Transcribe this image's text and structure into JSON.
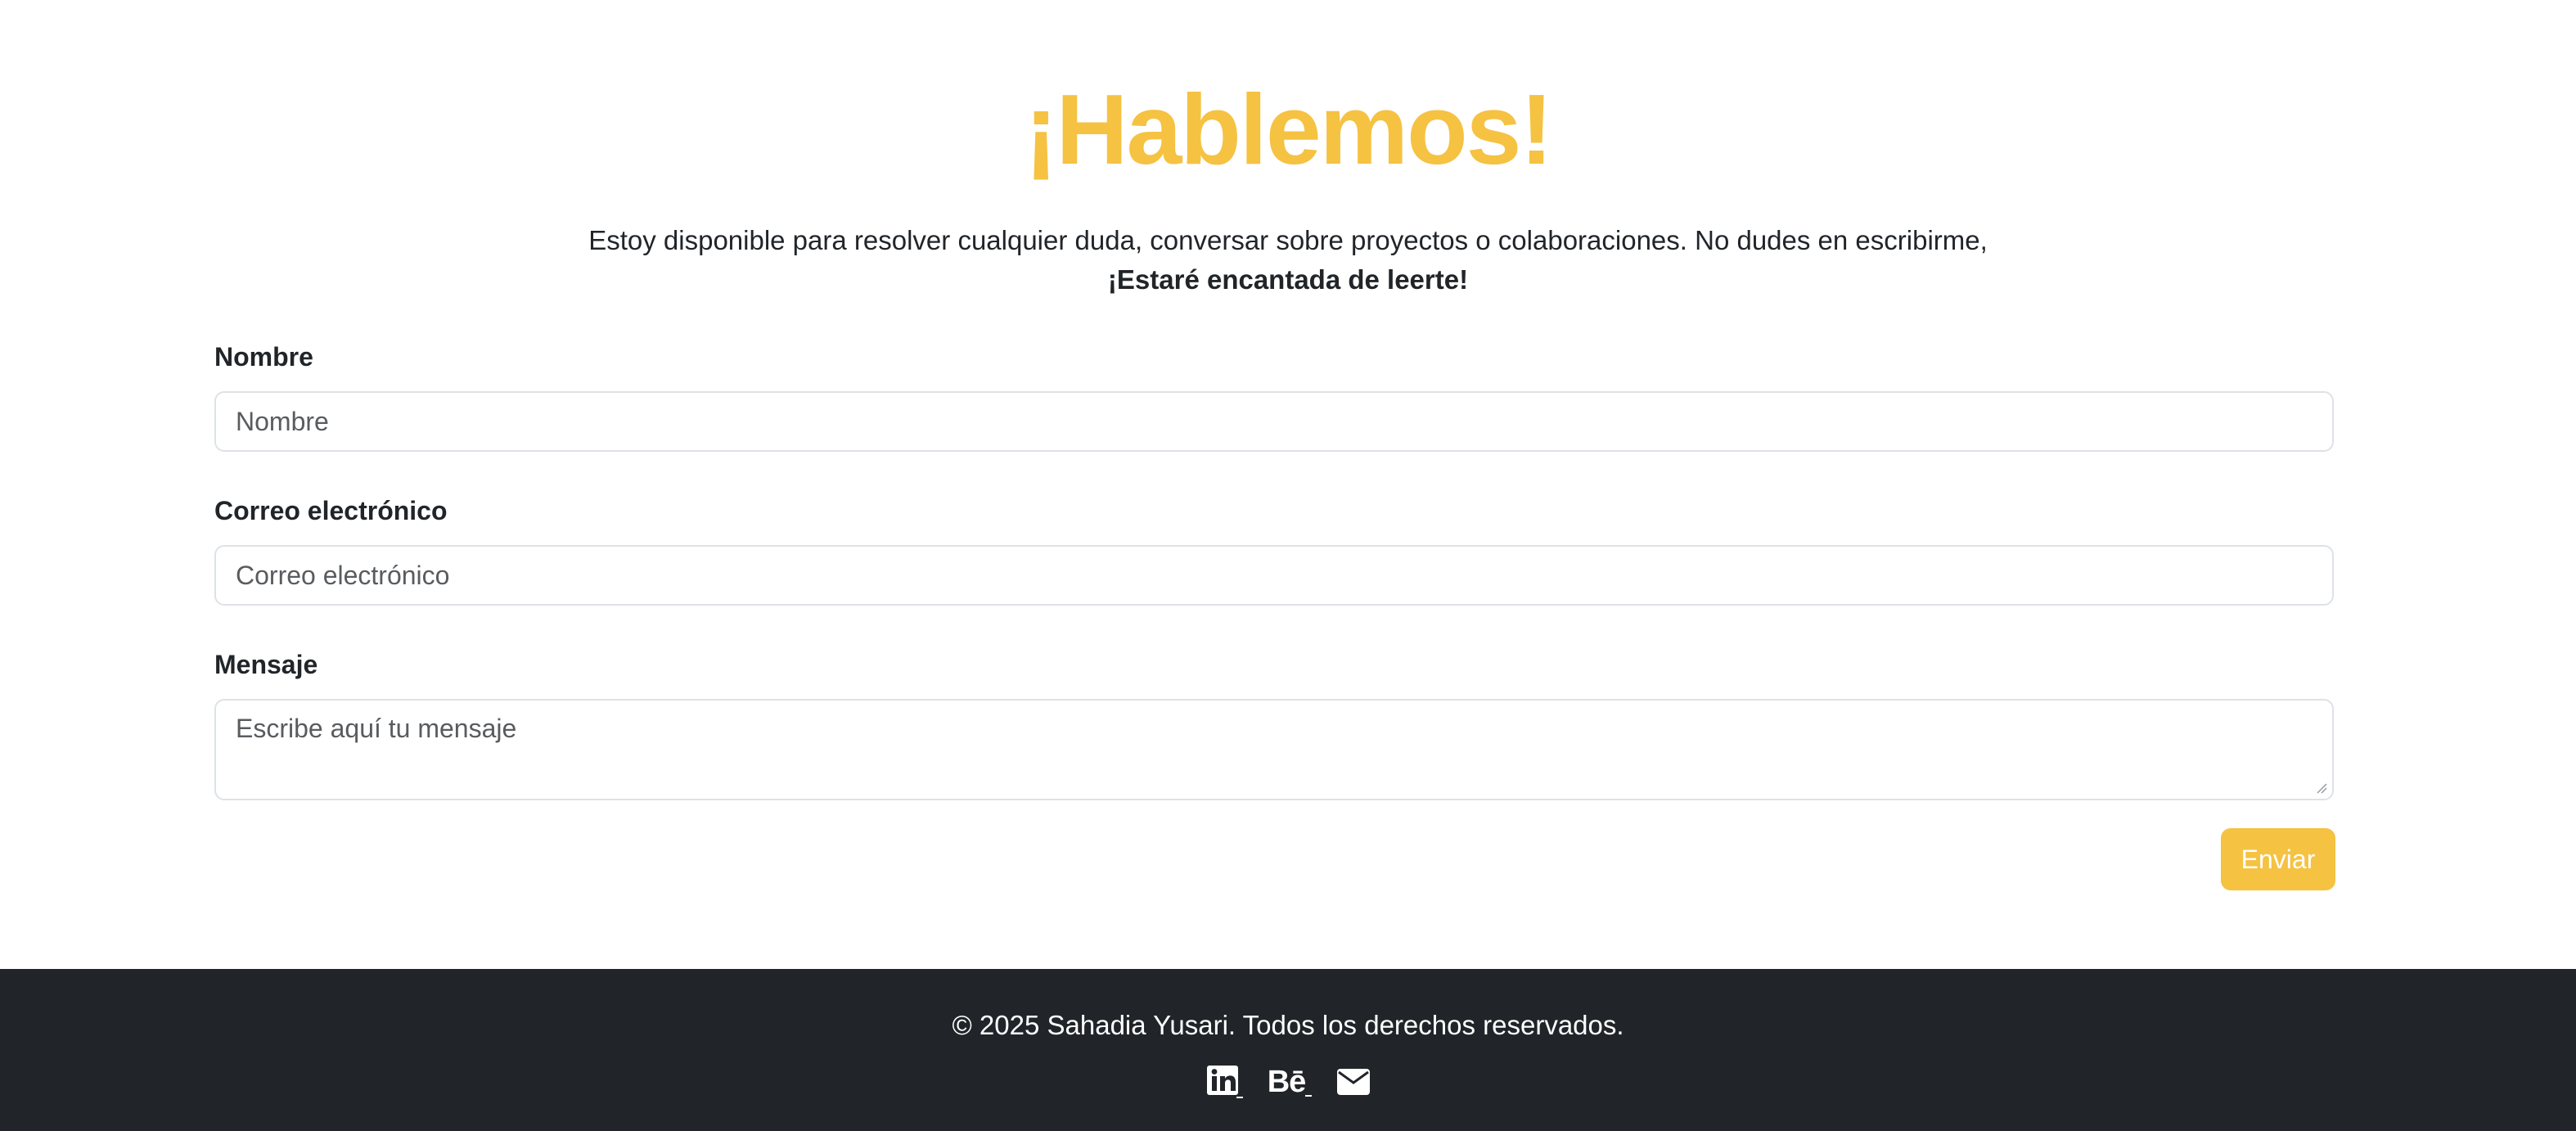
{
  "contact": {
    "title": "¡Hablemos!",
    "intro": "Estoy disponible para resolver cualquier duda, conversar sobre proyectos o colaboraciones. No dudes en escribirme,",
    "intro_strong": "¡Estaré encantada de leerte!",
    "fields": {
      "name": {
        "label": "Nombre",
        "placeholder": "Nombre"
      },
      "email": {
        "label": "Correo electrónico",
        "placeholder": "Correo electrónico"
      },
      "message": {
        "label": "Mensaje",
        "placeholder": "Escribe aquí tu mensaje"
      }
    },
    "submit_label": "Enviar"
  },
  "footer": {
    "copyright": "© 2025 Sahadia Yusari. Todos los derechos reservados.",
    "socials": [
      {
        "icon": "linkedin-icon"
      },
      {
        "icon": "behance-icon",
        "text": "Bē"
      },
      {
        "icon": "envelope-icon"
      }
    ]
  },
  "colors": {
    "accent": "#f5c242",
    "footer_bg": "#212529",
    "text": "#212529",
    "border": "#dee2e6"
  }
}
